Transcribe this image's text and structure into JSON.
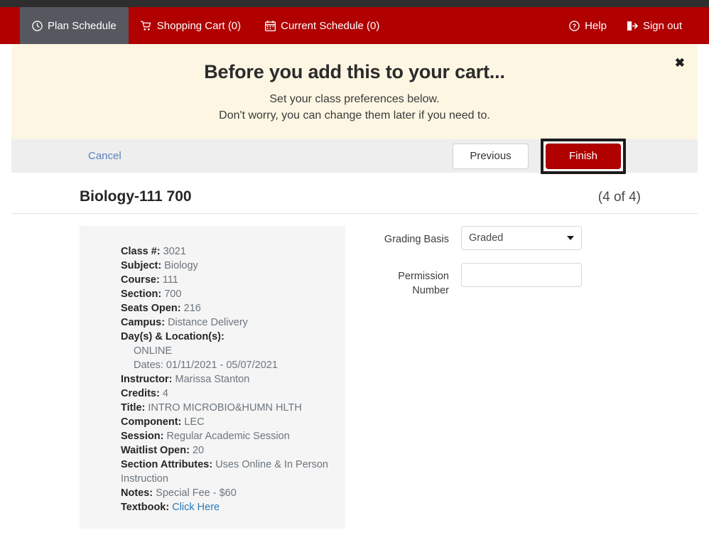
{
  "navbar": {
    "items": [
      {
        "label": "Plan Schedule",
        "icon": "clock-icon",
        "active": true
      },
      {
        "label": "Shopping Cart (0)",
        "icon": "cart-icon",
        "active": false
      },
      {
        "label": "Current Schedule (0)",
        "icon": "calendar-icon",
        "active": false
      }
    ],
    "right_items": [
      {
        "label": "Help",
        "icon": "question-circle-icon"
      },
      {
        "label": "Sign out",
        "icon": "sign-out-icon"
      }
    ],
    "brand_color": "#b00000",
    "active_tab_color": "#55585f"
  },
  "banner": {
    "title": "Before you add this to your cart...",
    "line1": "Set your class preferences below.",
    "line2": "Don't worry, you can change them later if you need to.",
    "close_label": "✖",
    "background": "#fdf6e3"
  },
  "actions": {
    "cancel_label": "Cancel",
    "previous_label": "Previous",
    "finish_label": "Finish",
    "finish_color": "#b00000"
  },
  "course": {
    "title": "Biology-111 700",
    "count": "(4 of 4)",
    "details": [
      {
        "label": "Class #:",
        "value": "3021"
      },
      {
        "label": "Subject:",
        "value": "Biology"
      },
      {
        "label": "Course:",
        "value": "111"
      },
      {
        "label": "Section:",
        "value": "700"
      },
      {
        "label": "Seats Open:",
        "value": "216"
      },
      {
        "label": "Campus:",
        "value": "Distance Delivery"
      },
      {
        "label": "Day(s) & Location(s):",
        "value": ""
      },
      {
        "label": "",
        "value": "ONLINE",
        "indent": true
      },
      {
        "label": "",
        "value": "Dates: 01/11/2021 - 05/07/2021",
        "indent": true
      },
      {
        "label": "Instructor:",
        "value": "Marissa Stanton"
      },
      {
        "label": "Credits:",
        "value": "4"
      },
      {
        "label": "Title:",
        "value": "INTRO MICROBIO&HUMN HLTH"
      },
      {
        "label": "Component:",
        "value": "LEC"
      },
      {
        "label": "Session:",
        "value": "Regular Academic Session"
      },
      {
        "label": "Waitlist Open:",
        "value": "20"
      },
      {
        "label": "Section Attributes:",
        "value": "Uses Online & In Person Instruction"
      },
      {
        "label": "Notes:",
        "value": "Special Fee - $60"
      },
      {
        "label": "Textbook:",
        "value": "Click Here",
        "link": true
      }
    ]
  },
  "form": {
    "grading_basis_label": "Grading Basis",
    "grading_basis_value": "Graded",
    "grading_basis_options": [
      "Graded"
    ],
    "permission_label_line1": "Permission",
    "permission_label_line2": "Number",
    "permission_value": "",
    "permission_placeholder": ""
  }
}
